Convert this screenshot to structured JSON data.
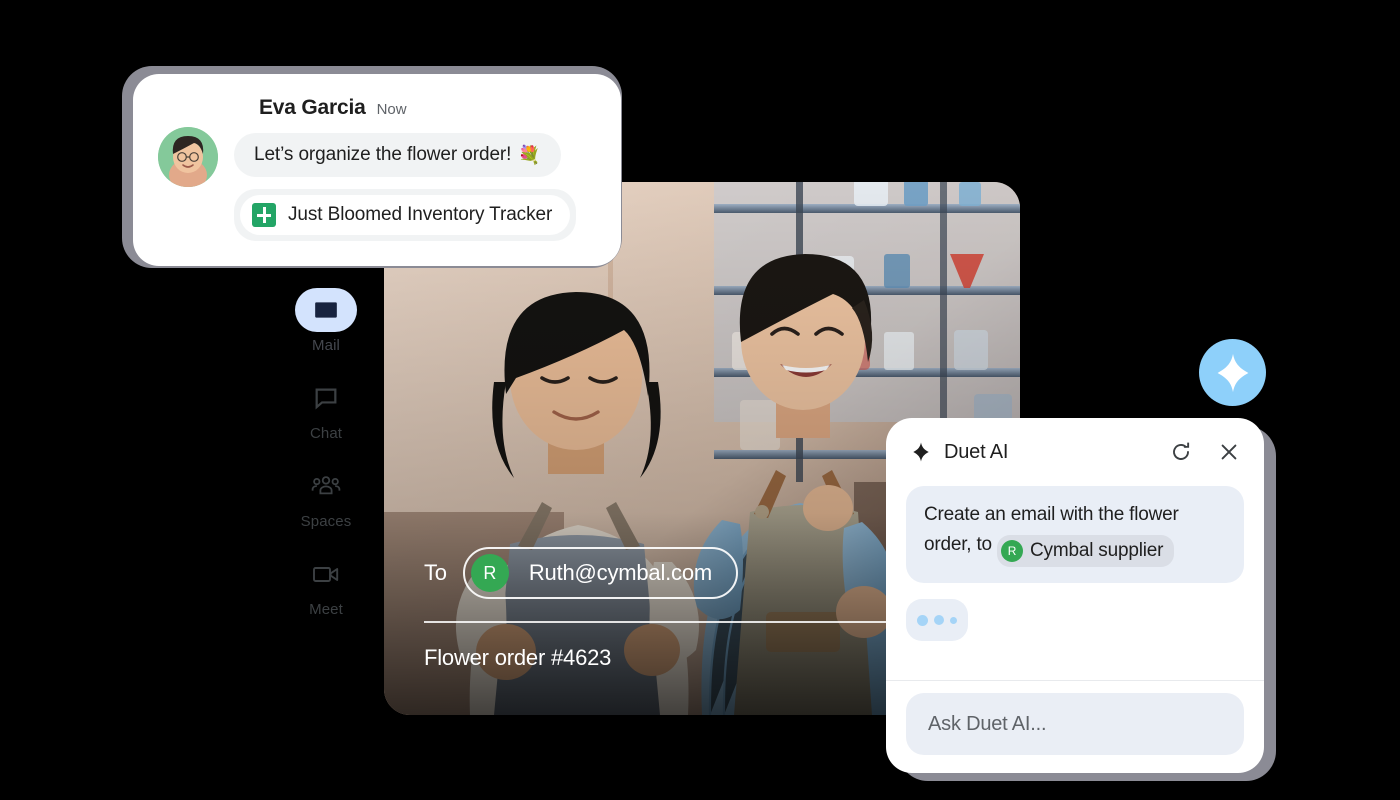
{
  "chat_notification": {
    "sender": "Eva Garcia",
    "timestamp": "Now",
    "avatar_name": "eva-garcia-avatar",
    "messages": [
      {
        "text": "Let’s organize the flower order!",
        "emoji": "💐"
      }
    ],
    "attachment": {
      "icon": "google-sheets-icon",
      "title": "Just Bloomed Inventory Tracker"
    }
  },
  "sidebar": {
    "items": [
      {
        "label": "Mail",
        "icon": "mail-icon",
        "active": true
      },
      {
        "label": "Chat",
        "icon": "chat-icon",
        "active": false
      },
      {
        "label": "Spaces",
        "icon": "spaces-icon",
        "active": false
      },
      {
        "label": "Meet",
        "icon": "meet-icon",
        "active": false
      }
    ],
    "active_pill_color": "#d3e3fd"
  },
  "compose": {
    "to_label": "To",
    "recipient": {
      "initial": "R",
      "email": "Ruth@cymbal.com",
      "avatar_color": "#34a853"
    },
    "subject": "Flower order #4623"
  },
  "duet_fab": {
    "icon": "sparkle-icon",
    "color": "#8ed0fa"
  },
  "duet_panel": {
    "title": "Duet AI",
    "title_icon": "sparkle-icon",
    "refresh_icon": "refresh-icon",
    "close_icon": "close-icon",
    "prompt": {
      "text_before": "Create an email with the flower order, to",
      "mention": {
        "initial": "R",
        "label": "Cymbal supplier",
        "avatar_color": "#34a853"
      }
    },
    "typing_indicator": {
      "visible": true,
      "dot_color": "#a5d4f7"
    },
    "input_placeholder": "Ask Duet AI..."
  }
}
